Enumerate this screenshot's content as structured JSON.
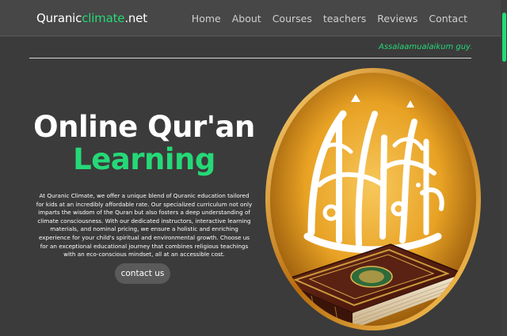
{
  "header": {
    "logo_part1": "Quranic",
    "logo_part2": "climate",
    "logo_part3": ".net",
    "nav": [
      "Home",
      "About",
      "Courses",
      "teachers",
      "Reviews",
      "Contact"
    ]
  },
  "marquee": {
    "text": "Assalaamualaikum guys it's m"
  },
  "hero": {
    "title_line1": "Online Qur'an",
    "title_line2": "Learning",
    "description": "At Quranic Climate, we offer a unique blend of Quranic education tailored for kids at an incredibly affordable rate. Our specialized curriculum not only imparts the wisdom of the Quran but also fosters a deep understanding of climate consciousness. With our dedicated instructors, interactive learning materials, and nominal pricing, we ensure a holistic and enriching experience for your child's spiritual and environmental growth. Choose us for an exceptional educational journey that combines religious teachings with an eco-conscious mindset, all at an accessible cost.",
    "button_label": "contact us"
  },
  "colors": {
    "accent": "#25d977",
    "background": "#3b3b3b",
    "header": "#474747",
    "gold": "#e0a224"
  }
}
